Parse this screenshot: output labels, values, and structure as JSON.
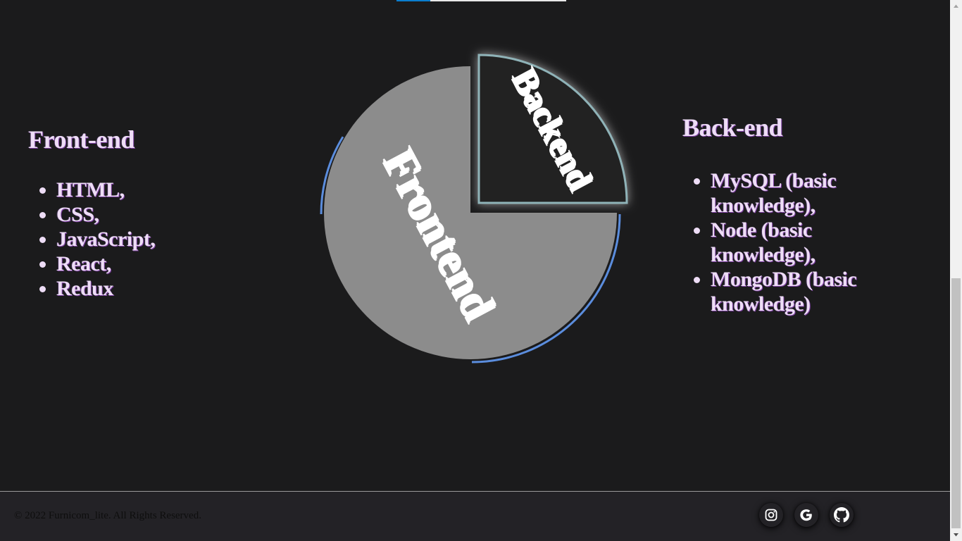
{
  "progress": {
    "value": 0.2,
    "fill_color": "#0a7ecf",
    "track_color": "#e8e8e8"
  },
  "frontend": {
    "title": "Front-end",
    "items": [
      "HTML,",
      "CSS,",
      "JavaScript,",
      "React,",
      "Redux"
    ]
  },
  "backend": {
    "title": "Back-end",
    "items": [
      "MySQL (basic knowledge),",
      "Node (basic knowledge),",
      "MongoDB (basic knowledge)"
    ]
  },
  "chart_data": {
    "type": "pie",
    "categories": [
      "Frontend",
      "Backend"
    ],
    "values": [
      75,
      25
    ],
    "colors": [
      "#8c8c8c",
      "#242424"
    ],
    "accent": "#5b8ddd"
  },
  "footer": {
    "copyright": "© 2022 Furnicom_lite. All Rights Reserved.",
    "social": [
      {
        "icon": "instagram-icon"
      },
      {
        "icon": "google-icon"
      },
      {
        "icon": "github-icon"
      }
    ]
  }
}
